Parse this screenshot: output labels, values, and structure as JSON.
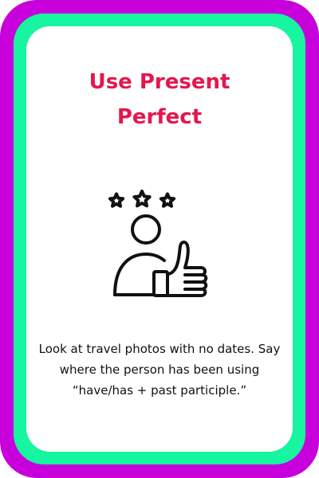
{
  "card": {
    "title_line1": "Use Present",
    "title_line2": "Perfect",
    "description": "Look at travel photos with no dates. Say where the person has been using “have/has + past participle.”",
    "icon": "person-thumbs-up-three-stars-icon",
    "colors": {
      "outer_border": "#c800dc",
      "inner_border": "#17f5a1",
      "background": "#ffffff",
      "title": "#e3174d",
      "text": "#111111"
    }
  }
}
